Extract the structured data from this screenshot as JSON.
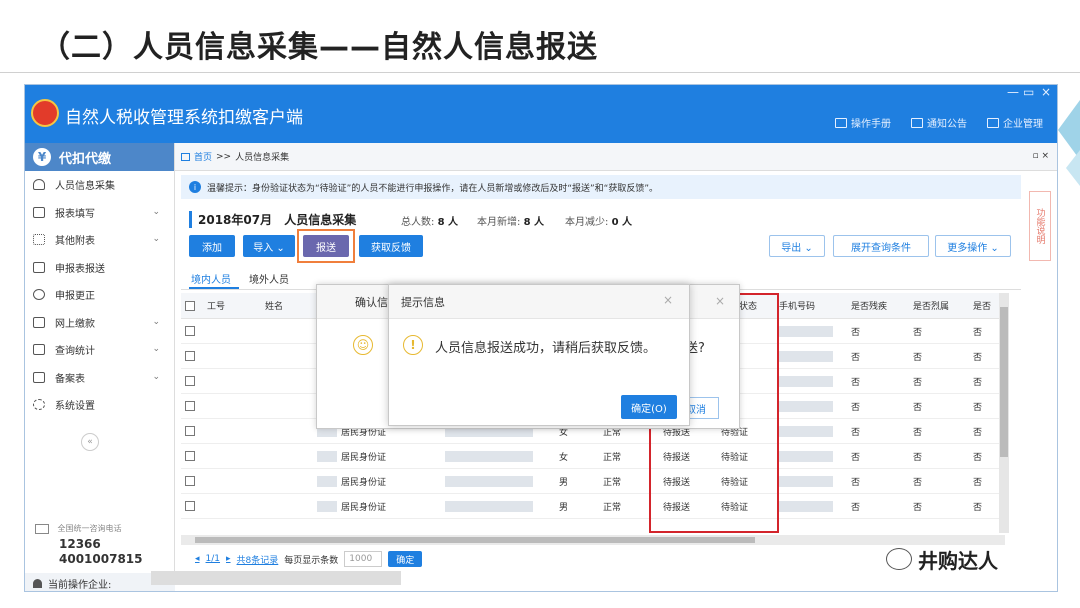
{
  "slide": {
    "title": "（二）人员信息采集——自然人信息报送"
  },
  "app": {
    "title": "自然人税收管理系统扣缴客户端",
    "header_links": [
      "操作手册",
      "通知公告",
      "企业管理"
    ],
    "window_controls": [
      "—",
      "▭",
      "×"
    ]
  },
  "sidebar": {
    "header": "代扣代缴",
    "items": [
      {
        "label": "人员信息采集",
        "icon": "user-icon",
        "chevron": ""
      },
      {
        "label": "报表填写",
        "icon": "edit-icon",
        "chevron": "⌄"
      },
      {
        "label": "其他附表",
        "icon": "grid-icon",
        "chevron": "⌄"
      },
      {
        "label": "申报表报送",
        "icon": "document-icon",
        "chevron": ""
      },
      {
        "label": "申报更正",
        "icon": "search-icon",
        "chevron": ""
      },
      {
        "label": "网上缴款",
        "icon": "folder-icon",
        "chevron": "⌄"
      },
      {
        "label": "查询统计",
        "icon": "list-icon",
        "chevron": "⌄"
      },
      {
        "label": "备案表",
        "icon": "file-icon",
        "chevron": "⌄"
      },
      {
        "label": "系统设置",
        "icon": "gear-icon",
        "chevron": ""
      }
    ],
    "collapse": "«",
    "phone_label": "全国统一咨询电话",
    "phone1": "12366",
    "phone2": "4001007815",
    "current_org_label": "当前操作企业:"
  },
  "breadcrumb": {
    "home": "首页",
    "sep": ">>",
    "current": "人员信息采集",
    "controls": "▫ ×"
  },
  "notice": {
    "text": "温馨提示：身份验证状态为“待验证”的人员不能进行申报操作，请在人员新增或修改后及时“报送”和“获取反馈”。"
  },
  "side_tab": {
    "label": "功能说明"
  },
  "summary": {
    "period": "2018年07月",
    "title": "人员信息采集",
    "total_label": "总人数:",
    "total_value": "8 人",
    "new_label": "本月新增:",
    "new_value": "8 人",
    "reduce_label": "本月减少:",
    "reduce_value": "0 人"
  },
  "toolbar": {
    "add": "添加",
    "import": "导入 ⌄",
    "report": "报送",
    "feedback": "获取反馈",
    "export": "导出 ⌄",
    "expand_query": "展开查询条件",
    "more": "更多操作 ⌄"
  },
  "tabs": {
    "domestic": "境内人员",
    "foreign": "境外人员"
  },
  "table": {
    "headers": [
      "",
      "工号",
      "姓名",
      "",
      "",
      "",
      "",
      "",
      "验证状态",
      "手机号码",
      "是否残疾",
      "是否烈属",
      "是否"
    ],
    "rows": [
      {
        "id_type": "",
        "gender": "",
        "status": "",
        "report": "",
        "verify": "证",
        "disabled": "否",
        "martyr": "否",
        "other": "否"
      },
      {
        "id_type": "",
        "gender": "",
        "status": "",
        "report": "",
        "verify": "证",
        "disabled": "否",
        "martyr": "否",
        "other": "否"
      },
      {
        "id_type": "",
        "gender": "",
        "status": "",
        "report": "",
        "verify": "证",
        "disabled": "否",
        "martyr": "否",
        "other": "否"
      },
      {
        "id_type": "",
        "gender": "",
        "status": "",
        "report": "",
        "verify": "证",
        "disabled": "否",
        "martyr": "否",
        "other": "否"
      },
      {
        "id_type": "居民身份证",
        "gender": "女",
        "status": "正常",
        "report": "待报送",
        "verify": "待验证",
        "disabled": "否",
        "martyr": "否",
        "other": "否"
      },
      {
        "id_type": "居民身份证",
        "gender": "女",
        "status": "正常",
        "report": "待报送",
        "verify": "待验证",
        "disabled": "否",
        "martyr": "否",
        "other": "否"
      },
      {
        "id_type": "居民身份证",
        "gender": "男",
        "status": "正常",
        "report": "待报送",
        "verify": "待验证",
        "disabled": "否",
        "martyr": "否",
        "other": "否"
      },
      {
        "id_type": "居民身份证",
        "gender": "男",
        "status": "正常",
        "report": "待报送",
        "verify": "待验证",
        "disabled": "否",
        "martyr": "否",
        "other": "否"
      }
    ]
  },
  "pager": {
    "prev": "◂",
    "page": "1/1",
    "next": "▸",
    "total": "共8条记录",
    "per_page_label": "每页显示条数",
    "per_page_value": "1000",
    "confirm": "确定"
  },
  "dialog_confirm": {
    "title": "确认信息",
    "partial_text": "送?",
    "cancel": "取消"
  },
  "dialog_info": {
    "title": "提示信息",
    "message": "人员信息报送成功，请稍后获取反馈。",
    "ok": "确定(O)"
  },
  "watermark": {
    "text": "井购达人"
  },
  "colors": {
    "primary": "#1f7fe0",
    "highlight_orange": "#f07f3c",
    "highlight_red": "#d3242b",
    "report_button": "#6a68ae"
  }
}
